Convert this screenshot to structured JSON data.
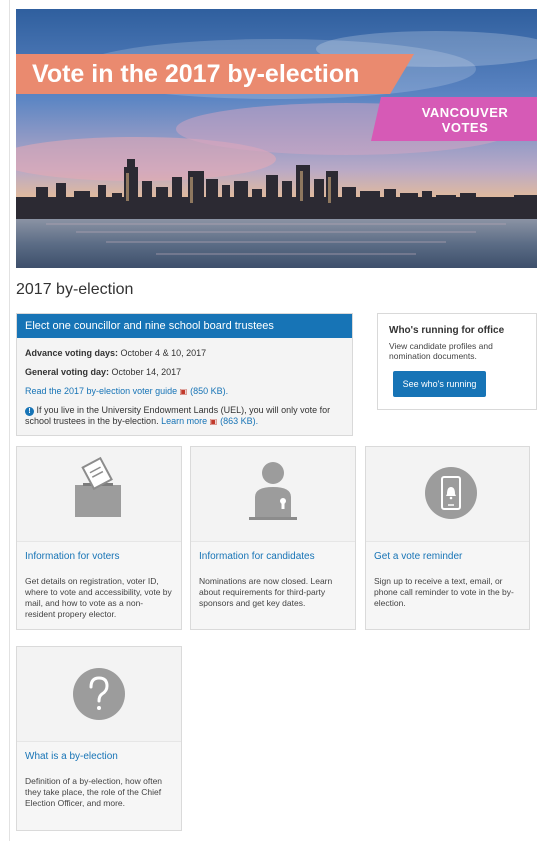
{
  "hero": {
    "title": "Vote in the 2017 by-election",
    "badge_line1": "VANCOUVER",
    "badge_line2": "VOTES",
    "colors": {
      "title_bg": "#ea8a6f",
      "badge_bg": "#d65ab6"
    }
  },
  "page_title": "2017 by-election",
  "election_card": {
    "header": "Elect one councillor and nine school board trustees",
    "advance_label": "Advance voting days:",
    "advance_value": "October 4 & 10, 2017",
    "general_label": "General voting day:",
    "general_value": "October 14, 2017",
    "guide_link": "Read the 2017 by-election voter guide",
    "guide_size": "(850 KB).",
    "uel_text": "If you live in the University Endowment Lands (UEL), you will only vote for school trustees in the by-election.",
    "learn_more": "Learn more",
    "learn_size": "(863 KB).",
    "header_color": "#1774b6"
  },
  "running_card": {
    "title": "Who's running for office",
    "description": "View candidate profiles and nomination documents.",
    "button": "See who's running"
  },
  "tiles": [
    {
      "title": "Information for voters",
      "description": "Get details on registration, voter ID, where to vote and accessibility, vote by mail, and how to vote as a non-resident propery elector.",
      "icon": "ballot-box-icon"
    },
    {
      "title": "Information for candidates",
      "description": "Nominations are now closed. Learn about requirements for third-party sponsors and get key dates.",
      "icon": "candidate-icon"
    },
    {
      "title": "Get a vote reminder",
      "description": "Sign up to receive a text, email, or phone call reminder to vote in the by-election.",
      "icon": "phone-alert-icon"
    },
    {
      "title": "What is a by-election",
      "description": "Definition of a by-election, how often they take place, the role of the Chief Election Officer, and more.",
      "icon": "question-icon"
    }
  ]
}
